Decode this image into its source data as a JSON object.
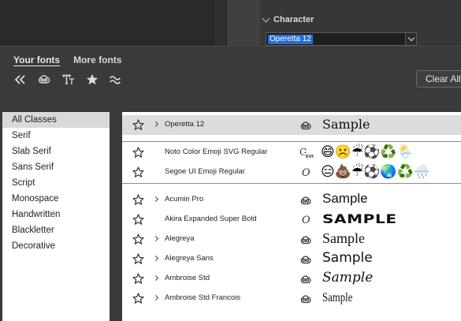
{
  "panel": {
    "section_title": "Character",
    "font_field_value": "Operetta 12"
  },
  "popup": {
    "tabs": [
      "Your fonts",
      "More fonts"
    ],
    "filters": [
      "collapse-icon",
      "creative-cloud-icon",
      "similar-fonts-icon",
      "favorites-star-icon",
      "similar-shape-icon"
    ],
    "clear_all_label": "Clear All"
  },
  "classes": [
    "All Classes",
    "Serif",
    "Slab Serif",
    "Sans Serif",
    "Script",
    "Monospace",
    "Handwritten",
    "Blackletter",
    "Decorative"
  ],
  "selected_class": "All Classes",
  "fonts": {
    "recent": [
      {
        "name": "Operetta 12",
        "source": "adobe-fonts",
        "sample": "Sample",
        "expandable": true,
        "selected": true
      }
    ],
    "emoji": [
      {
        "name": "Noto Color Emoji SVG Regular",
        "source": "opentype-svg",
        "sample": "😄☹️☔⚽♻️🌦️",
        "expandable": false
      },
      {
        "name": "Segoe UI Emoji Regular",
        "source": "opentype",
        "sample": "😑💩☔⚽🌏♻️🌧️",
        "expandable": false
      }
    ],
    "all": [
      {
        "name": "Acumin Pro",
        "source": "adobe-fonts",
        "sample": "Sample",
        "expandable": true
      },
      {
        "name": "Akira Expanded Super Bold",
        "source": "opentype",
        "sample": "SAMPLE",
        "expandable": false
      },
      {
        "name": "Alegreya",
        "source": "adobe-fonts",
        "sample": "Sample",
        "expandable": true
      },
      {
        "name": "Alegreya Sans",
        "source": "adobe-fonts",
        "sample": "Sample",
        "expandable": true
      },
      {
        "name": "Ambroise Std",
        "source": "adobe-fonts",
        "sample": "Sample",
        "expandable": true
      },
      {
        "name": "Ambroise Std Francois",
        "source": "adobe-fonts",
        "sample": "Sample",
        "expandable": true
      }
    ]
  }
}
